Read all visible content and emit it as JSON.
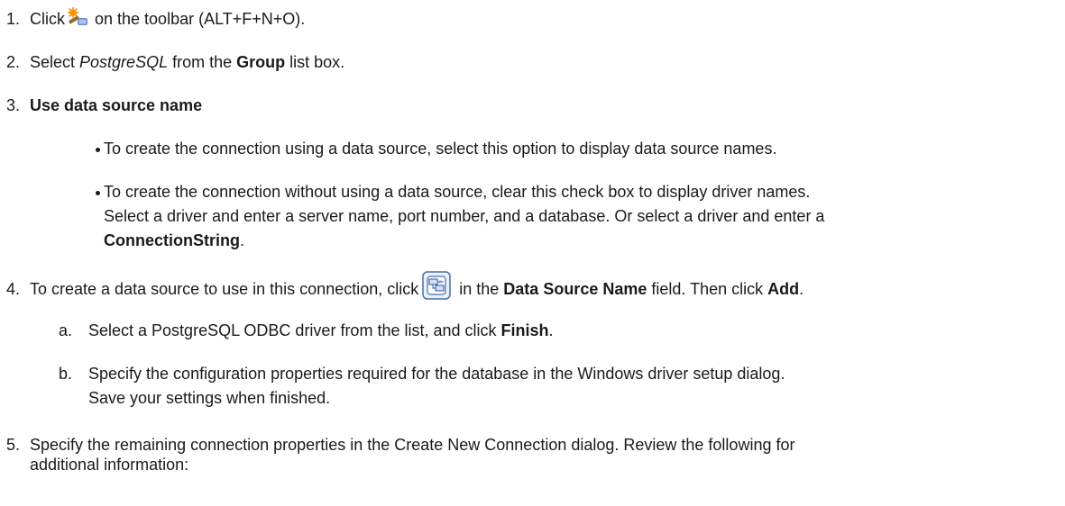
{
  "steps": [
    {
      "num": "1.",
      "pre": "Click",
      "icon": "new-connection-icon",
      "post": " on the toolbar (ALT+F+N+O)."
    },
    {
      "num": "2.",
      "pre": "Select ",
      "italic": "PostgreSQL",
      "mid": " from the ",
      "bold": "Group",
      "post": " list box."
    },
    {
      "num": "3.",
      "bold": "Use data source name",
      "bullets": [
        {
          "text": "To create the connection using a data source, select this option to display data source names."
        },
        {
          "line1": "To create the connection without using a data source, clear this check box to display driver names.",
          "line2": "Select a driver and enter a server name, port number, and a database. Or select a driver and enter a",
          "bold": "ConnectionString",
          "end": "."
        }
      ]
    },
    {
      "num": "4.",
      "pre": "To create a data source to use in this connection, click",
      "icon": "data-source-browse-icon",
      "mid1": " in the ",
      "bold1": "Data Source Name",
      "mid2": " field. Then click ",
      "bold2": "Add",
      "end": ".",
      "substeps": [
        {
          "label": "a.",
          "pre": "Select a PostgreSQL ODBC driver from the list, and click ",
          "bold": "Finish",
          "end": "."
        },
        {
          "label": "b.",
          "line1": "Specify the configuration properties required for the database in the Windows driver setup dialog.",
          "line2": "Save your settings when finished."
        }
      ]
    },
    {
      "num": "5.",
      "line1": "Specify the remaining connection properties in the Create New Connection dialog. Review the following for",
      "line2": "additional information:"
    }
  ]
}
